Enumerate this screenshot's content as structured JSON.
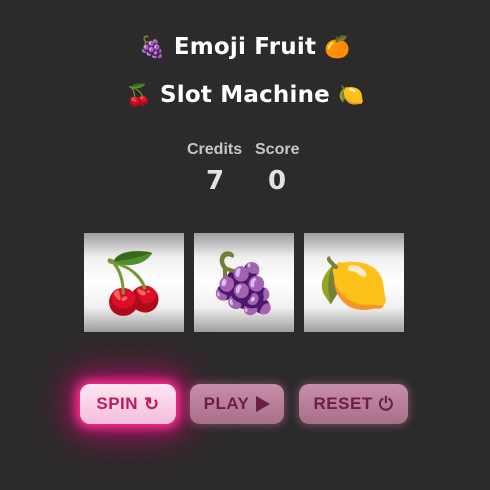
{
  "title": {
    "line1": {
      "left_emoji": "🍇",
      "text": "Emoji Fruit",
      "right_emoji": "🍊"
    },
    "line2": {
      "left_emoji": "🍒",
      "text": "Slot Machine",
      "right_emoji": "🍋"
    }
  },
  "stats": {
    "credits_label": "Credits",
    "credits_value": "7",
    "score_label": "Score",
    "score_value": "0"
  },
  "reels": [
    {
      "symbol": "🍒",
      "icon": "cherry-icon"
    },
    {
      "symbol": "🍇",
      "icon": "grapes-icon"
    },
    {
      "symbol": "🍋",
      "icon": "lemon-icon"
    }
  ],
  "buttons": {
    "spin_label": "SPIN",
    "spin_icon": "↻",
    "play_label": "PLAY",
    "reset_label": "RESET",
    "reset_icon": "⏻"
  },
  "colors": {
    "background": "#2b2b2b",
    "button_text": "#c2185b",
    "glow": "#ff2e97"
  }
}
